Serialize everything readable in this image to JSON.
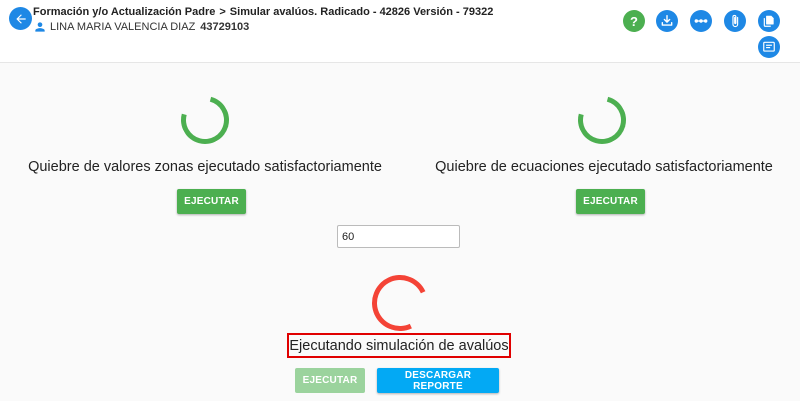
{
  "header": {
    "breadcrumb": [
      "Formación y/o Actualización Padre",
      "Simular avalúos. Radicado - 42826 Versión - 79322"
    ],
    "user_name": "LINA MARIA VALENCIA DIAZ",
    "user_id": "43729103"
  },
  "toolbar": {
    "help_label": "?"
  },
  "panels": [
    {
      "label": "Quiebre de valores zonas ejecutado satisfactoriamente",
      "button": "EJECUTAR"
    },
    {
      "label": "Quiebre de ecuaciones ejecutado satisfactoriamente",
      "button": "EJECUTAR"
    }
  ],
  "simulation": {
    "input_value": "60",
    "status": "Ejecutando simulación de avalúos",
    "execute_button": "EJECUTAR",
    "download_button": "DESCARGAR REPORTE"
  },
  "colors": {
    "primary": "#1e88e5",
    "success": "#4caf50",
    "danger": "#f44336",
    "highlight_border": "#e00000",
    "download": "#03a9f4"
  }
}
